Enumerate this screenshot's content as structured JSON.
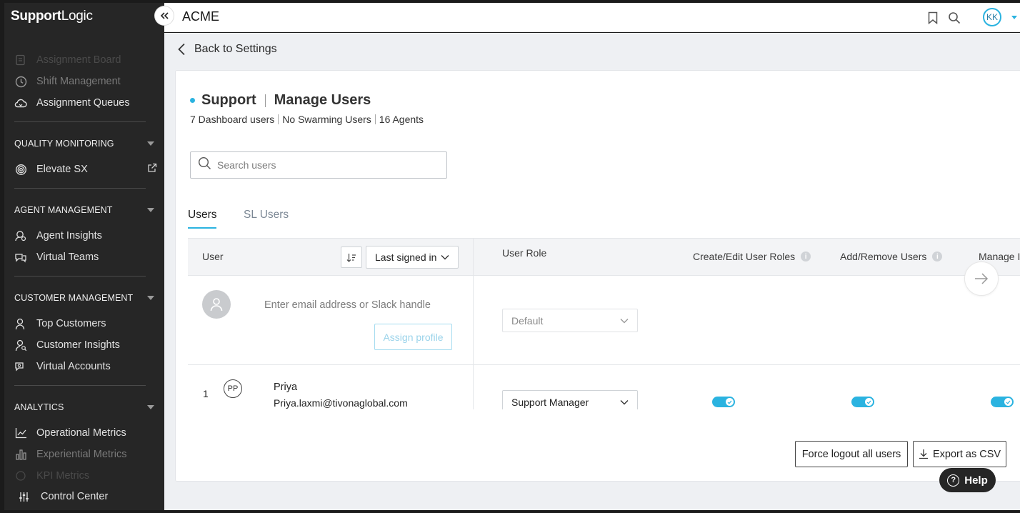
{
  "brand": {
    "bold": "Support",
    "light": "Logic"
  },
  "sidebar": {
    "top_items": [
      {
        "label": "Assignment Board",
        "icon": "board-icon"
      },
      {
        "label": "Shift Management",
        "icon": "clock-icon"
      },
      {
        "label": "Assignment Queues",
        "icon": "cloud-icon"
      }
    ],
    "sections": [
      {
        "title": "QUALITY MONITORING",
        "items": [
          {
            "label": "Elevate SX",
            "icon": "fingerprint-icon"
          }
        ]
      },
      {
        "title": "AGENT MANAGEMENT",
        "items": [
          {
            "label": "Agent Insights",
            "icon": "agent-insights-icon"
          },
          {
            "label": "Virtual Teams",
            "icon": "virtual-teams-icon"
          }
        ]
      },
      {
        "title": "CUSTOMER MANAGEMENT",
        "items": [
          {
            "label": "Top Customers",
            "icon": "customer-icon"
          },
          {
            "label": "Customer Insights",
            "icon": "customer-search-icon"
          },
          {
            "label": "Virtual Accounts",
            "icon": "virtual-accounts-icon"
          }
        ]
      },
      {
        "title": "ANALYTICS",
        "items": [
          {
            "label": "Operational Metrics",
            "icon": "line-chart-icon"
          },
          {
            "label": "Experiential Metrics",
            "icon": "bar-chart-icon"
          },
          {
            "label": "KPI Metrics",
            "icon": "kpi-icon"
          }
        ]
      }
    ],
    "control_center": "Control Center"
  },
  "topbar": {
    "org": "ACME",
    "avatar_initials": "KK"
  },
  "back_label": "Back to Settings",
  "page": {
    "title_left": "Support",
    "title_right": "Manage Users",
    "stats": [
      "7 Dashboard users",
      "No Swarming Users",
      "16 Agents"
    ],
    "search_placeholder": "Search users"
  },
  "tabs": [
    "Users",
    "SL Users"
  ],
  "table": {
    "headers": {
      "user": "User",
      "sort_select": "Last signed in",
      "role": "User Role",
      "perm1": "Create/Edit User Roles",
      "perm2": "Add/Remove Users",
      "perm3": "Manage I"
    },
    "new_user": {
      "placeholder": "Enter email address or Slack handle",
      "assign_label": "Assign profile",
      "role_default": "Default"
    },
    "rows": [
      {
        "index": "1",
        "initials": "PP",
        "name": "Priya",
        "email": "Priya.laxmi@tivonaglobal.com",
        "role": "Support Manager",
        "perms": [
          true,
          true,
          true
        ]
      }
    ]
  },
  "actions": {
    "force_logout": "Force logout all users",
    "export_csv": "Export as CSV"
  },
  "help_label": "Help",
  "colors": {
    "accent": "#2bb3e0",
    "sidebar_bg": "#262626"
  }
}
